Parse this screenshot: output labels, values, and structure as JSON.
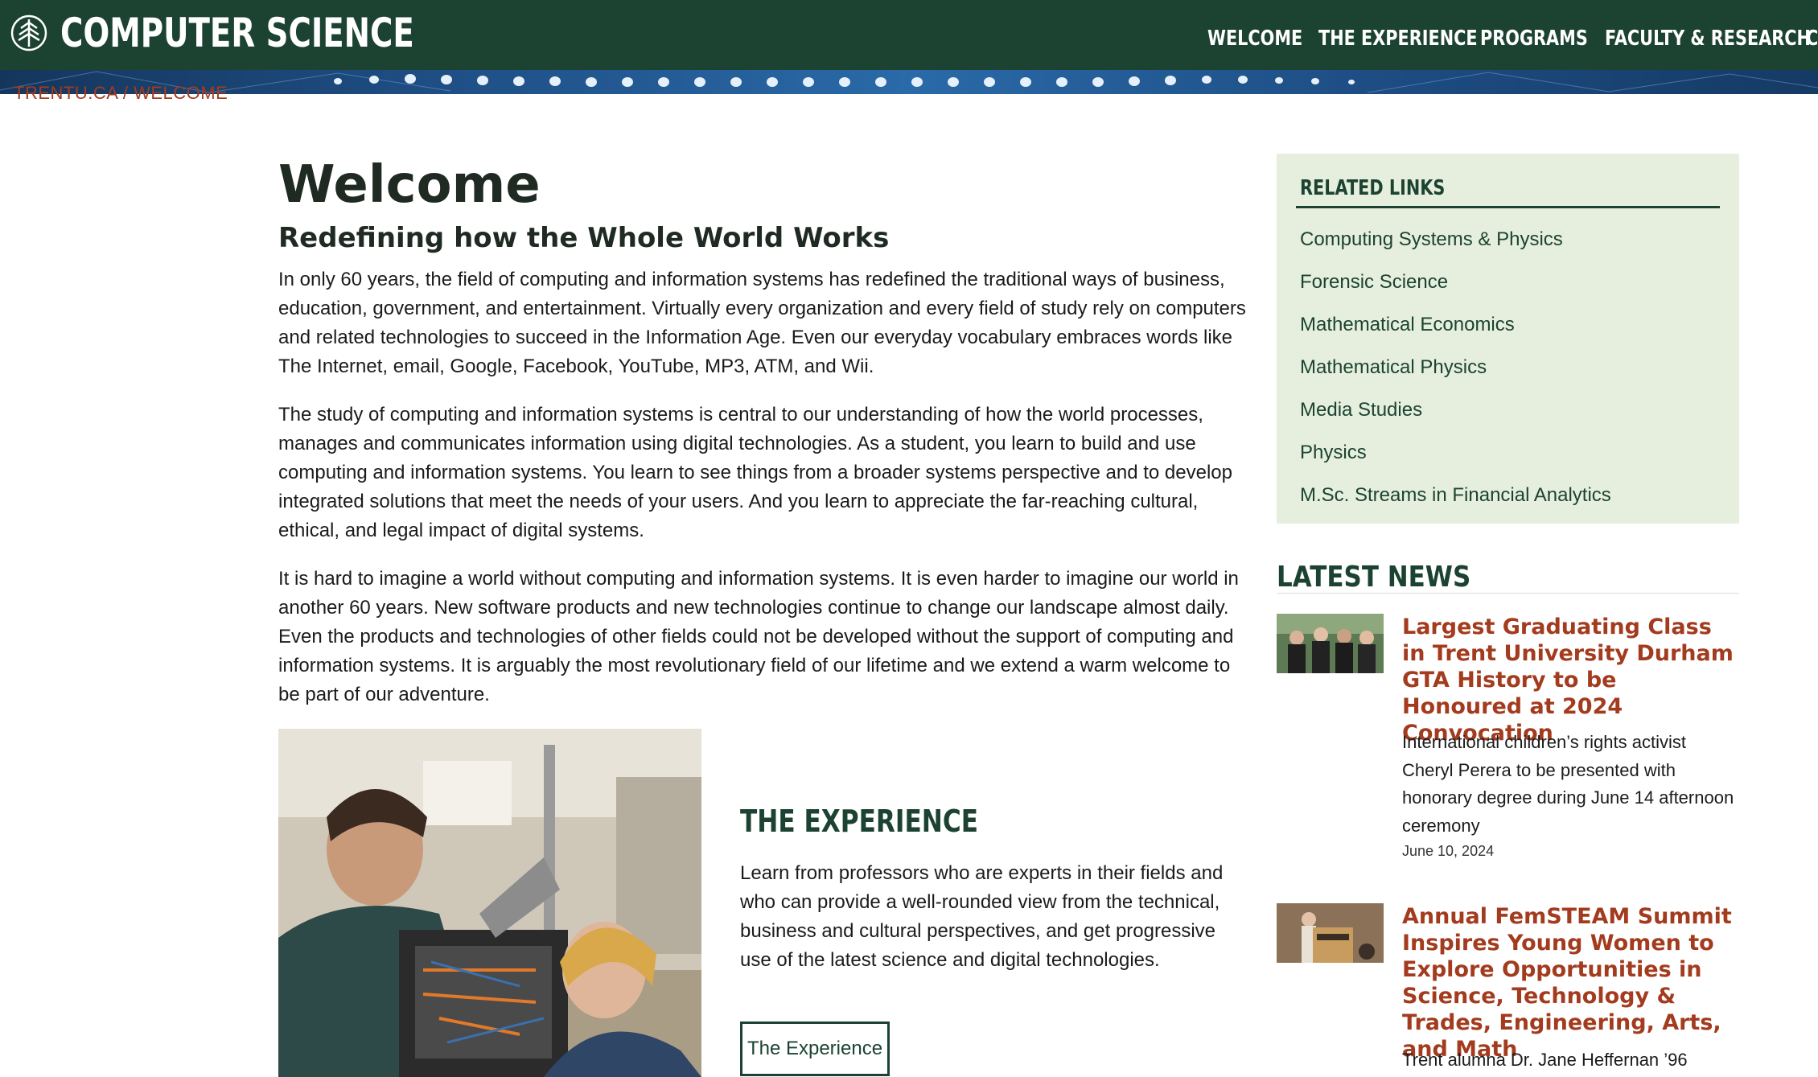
{
  "header": {
    "site_title": "COMPUTER SCIENCE",
    "logo_icon": "trent-tree-icon",
    "nav": [
      {
        "label": "WELCOME"
      },
      {
        "label": "THE EXPERIENCE"
      },
      {
        "label": "PROGRAMS"
      },
      {
        "label": "FACULTY & RESEARCH"
      },
      {
        "label": "C"
      }
    ],
    "brand_color": "#1c4332"
  },
  "breadcrumb": {
    "items": [
      "TRENTU.CA",
      "WELCOME"
    ],
    "separator": "/"
  },
  "main": {
    "title": "Welcome",
    "subtitle": "Redefining how the Whole World Works",
    "paragraphs": [
      "In only 60 years, the field of computing and information systems has redefined the traditional ways of business, education, government, and entertainment.  Virtually every organization and every field of study rely on computers and related technologies to succeed in the Information Age.  Even our everyday vocabulary embraces words like The Internet, email, Google, Facebook, YouTube, MP3, ATM, and Wii.",
      "The study of computing and information systems is central to our understanding of how the world processes, manages and communicates information using digital technologies.  As a student, you learn to build and use computing and information systems.  You learn to see things from a broader systems perspective and to develop integrated solutions that meet the needs of your users.  And you learn to appreciate the far-reaching cultural, ethical, and legal impact of digital systems.",
      "It is hard to imagine a world without computing and information systems.  It is even harder to imagine our world in another 60 years.  New software products and new technologies continue to change our landscape almost daily.  Even the products and technologies of other fields could not be developed without the support of computing and information systems.  It is arguably the most revolutionary field of our lifetime and we extend a warm welcome to be part of our adventure."
    ],
    "experience": {
      "title": "THE EXPERIENCE",
      "text": "Learn from professors who are experts in their fields and who can provide a well-rounded view from the technical, business and cultural perspectives, and get progressive use of the latest science and digital technologies.",
      "button_label": "The Experience"
    }
  },
  "sidebar": {
    "related_title": "RELATED LINKS",
    "related_links": [
      "Computing Systems & Physics",
      "Forensic Science",
      "Mathematical Economics",
      "Mathematical Physics",
      "Media Studies",
      "Physics",
      "M.Sc. Streams in Financial Analytics"
    ],
    "news_title": "LATEST NEWS",
    "news": [
      {
        "headline": "Largest Graduating Class in Trent University Durham GTA History to be Honoured at 2024 Convocation",
        "summary": "International children’s rights activist Cheryl Perera to be presented with honorary degree during June 14 afternoon ceremony",
        "date": "June 10, 2024"
      },
      {
        "headline": "Annual FemSTEAM Summit Inspires Young Women to Explore Opportunities in Science, Technology & Trades, Engineering, Arts, and Math",
        "summary": "Trent alumna Dr. Jane Heffernan ’96",
        "date": ""
      }
    ],
    "accent_color": "#a33b1e",
    "panel_color": "#e6efdd"
  }
}
